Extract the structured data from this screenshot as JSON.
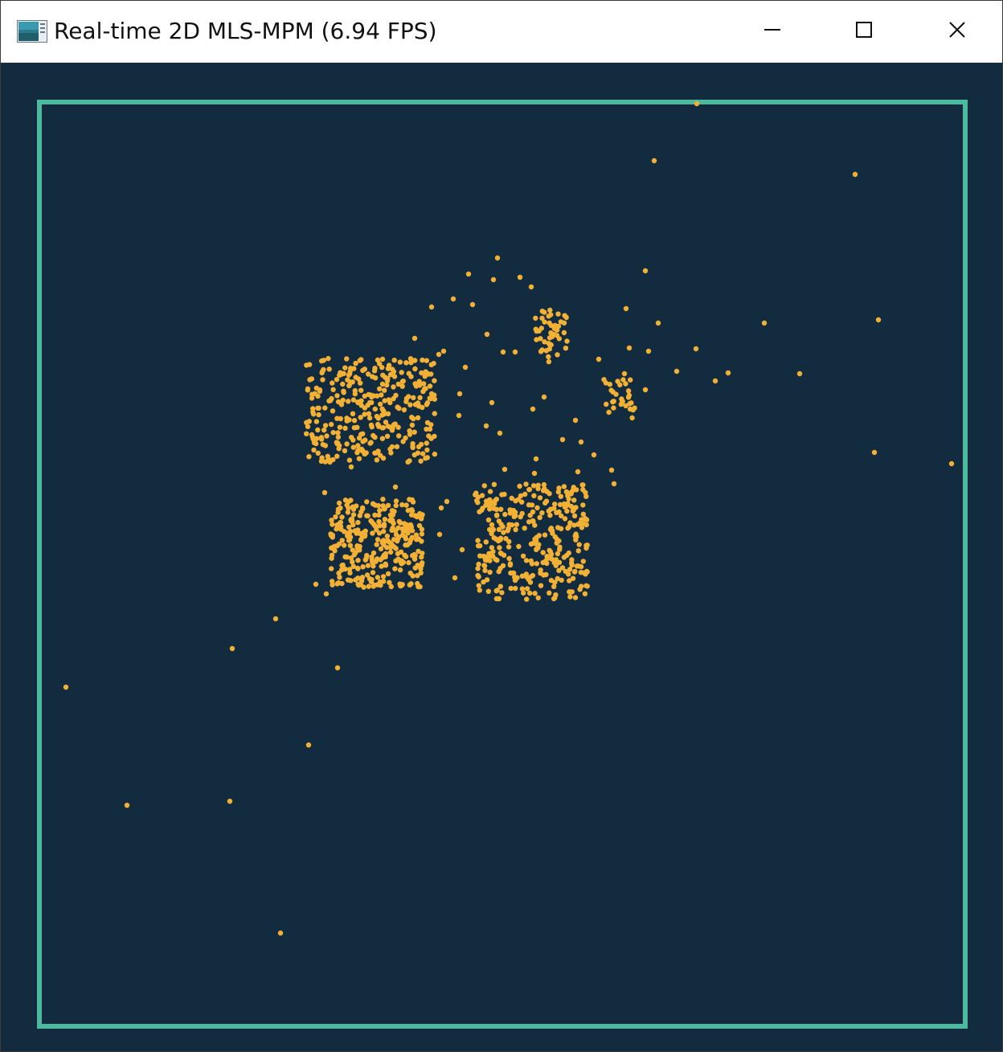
{
  "window": {
    "title": "Real-time 2D MLS-MPM (6.94 FPS)",
    "controls": {
      "minimize": "minimize",
      "maximize": "maximize",
      "close": "close"
    }
  },
  "icons": {
    "app": "app-window-icon",
    "minimize": "minimize-icon",
    "maximize": "maximize-icon",
    "close": "close-icon"
  },
  "colors": {
    "titlebar_bg": "#ffffff",
    "canvas_bg": "#132b3f",
    "boundary": "#4fb99f",
    "particle": "#f2b134"
  }
}
